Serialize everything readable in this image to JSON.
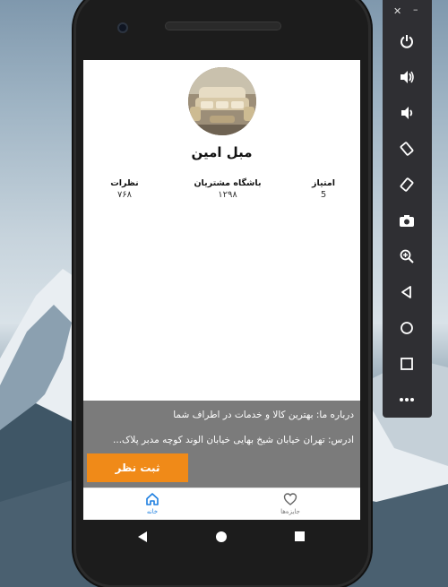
{
  "profile": {
    "name": "مبل امین",
    "avatar_alt": "furniture photo"
  },
  "stats": [
    {
      "label": "امتیاز",
      "value": "5"
    },
    {
      "label": "باشگاه مشتریان",
      "value": "۱۲۹۸"
    },
    {
      "label": "نظرات",
      "value": "۷۶۸"
    }
  ],
  "info": {
    "about": "درباره ما: بهترین کالا و خدمات در اطراف شما",
    "address": "ادرس: تهران خیابان شیخ بهایی خیابان الوند کوچه مدبر پلاک...",
    "submit_label": "ثبت نظر"
  },
  "bottom_nav": {
    "home_label": "خانه",
    "rewards_label": "جایزه‌ها"
  },
  "colors": {
    "accent_orange": "#f08a18",
    "nav_active_blue": "#1e7fe0",
    "info_panel_gray": "#7b7b7b"
  },
  "icons": {
    "home": "home-icon",
    "rewards": "heart-icon",
    "back": "back-triangle-icon",
    "home_sys": "circle-icon",
    "recents": "square-icon"
  },
  "toolbar": {
    "buttons": [
      "power-icon",
      "volume-up-icon",
      "volume-down-icon",
      "rotate-left-icon",
      "rotate-right-icon",
      "camera-icon",
      "zoom-icon",
      "back-icon",
      "home-icon",
      "overview-icon",
      "more-icon"
    ]
  }
}
